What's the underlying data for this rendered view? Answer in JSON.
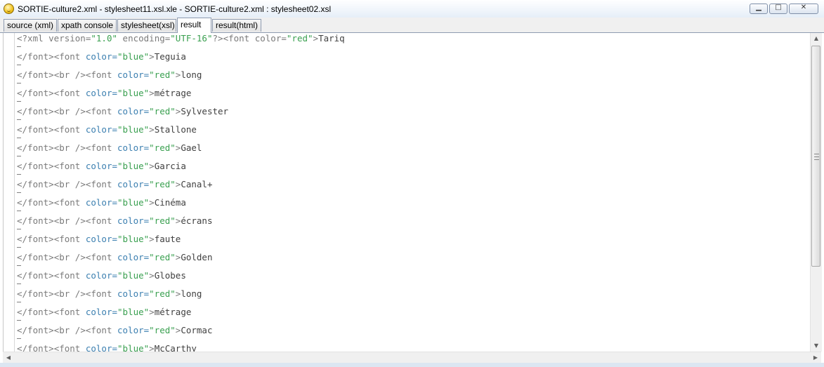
{
  "window": {
    "title": "SORTIE-culture2.xml - stylesheet11.xsl.xle - SORTIE-culture2.xml : stylesheet02.xsl",
    "minimize_glyph": "▁",
    "maximize_glyph": "□",
    "close_glyph": "✕"
  },
  "tabs": [
    {
      "label": "source (xml)"
    },
    {
      "label": "xpath console"
    },
    {
      "label": "stylesheet(xsl)"
    },
    {
      "label": "result",
      "active": true
    },
    {
      "label": "result(html)"
    }
  ],
  "editor": {
    "first_line": {
      "decl": "<?xml version=\"1.0\" encoding=\"UTF-16\"?>",
      "open_tag": "<font color=\"red\">",
      "word": "Tariq"
    },
    "lines": [
      {
        "br": false,
        "color": "blue",
        "word": "Teguia"
      },
      {
        "br": true,
        "color": "red",
        "word": "long"
      },
      {
        "br": false,
        "color": "blue",
        "word": "métrage"
      },
      {
        "br": true,
        "color": "red",
        "word": "Sylvester"
      },
      {
        "br": false,
        "color": "blue",
        "word": "Stallone"
      },
      {
        "br": true,
        "color": "red",
        "word": "Gael"
      },
      {
        "br": false,
        "color": "blue",
        "word": "Garcia"
      },
      {
        "br": true,
        "color": "red",
        "word": "Canal+"
      },
      {
        "br": false,
        "color": "blue",
        "word": "Cinéma"
      },
      {
        "br": true,
        "color": "red",
        "word": "écrans"
      },
      {
        "br": false,
        "color": "blue",
        "word": "faute"
      },
      {
        "br": true,
        "color": "red",
        "word": "Golden"
      },
      {
        "br": false,
        "color": "blue",
        "word": "Globes"
      },
      {
        "br": true,
        "color": "red",
        "word": "long"
      },
      {
        "br": false,
        "color": "blue",
        "word": "métrage"
      },
      {
        "br": true,
        "color": "red",
        "word": "Cormac"
      },
      {
        "br": false,
        "color": "blue",
        "word": "McCarthy"
      }
    ]
  },
  "scrollbars": {
    "up_glyph": "▲",
    "down_glyph": "▼",
    "left_glyph": "◀",
    "right_glyph": "▶"
  }
}
